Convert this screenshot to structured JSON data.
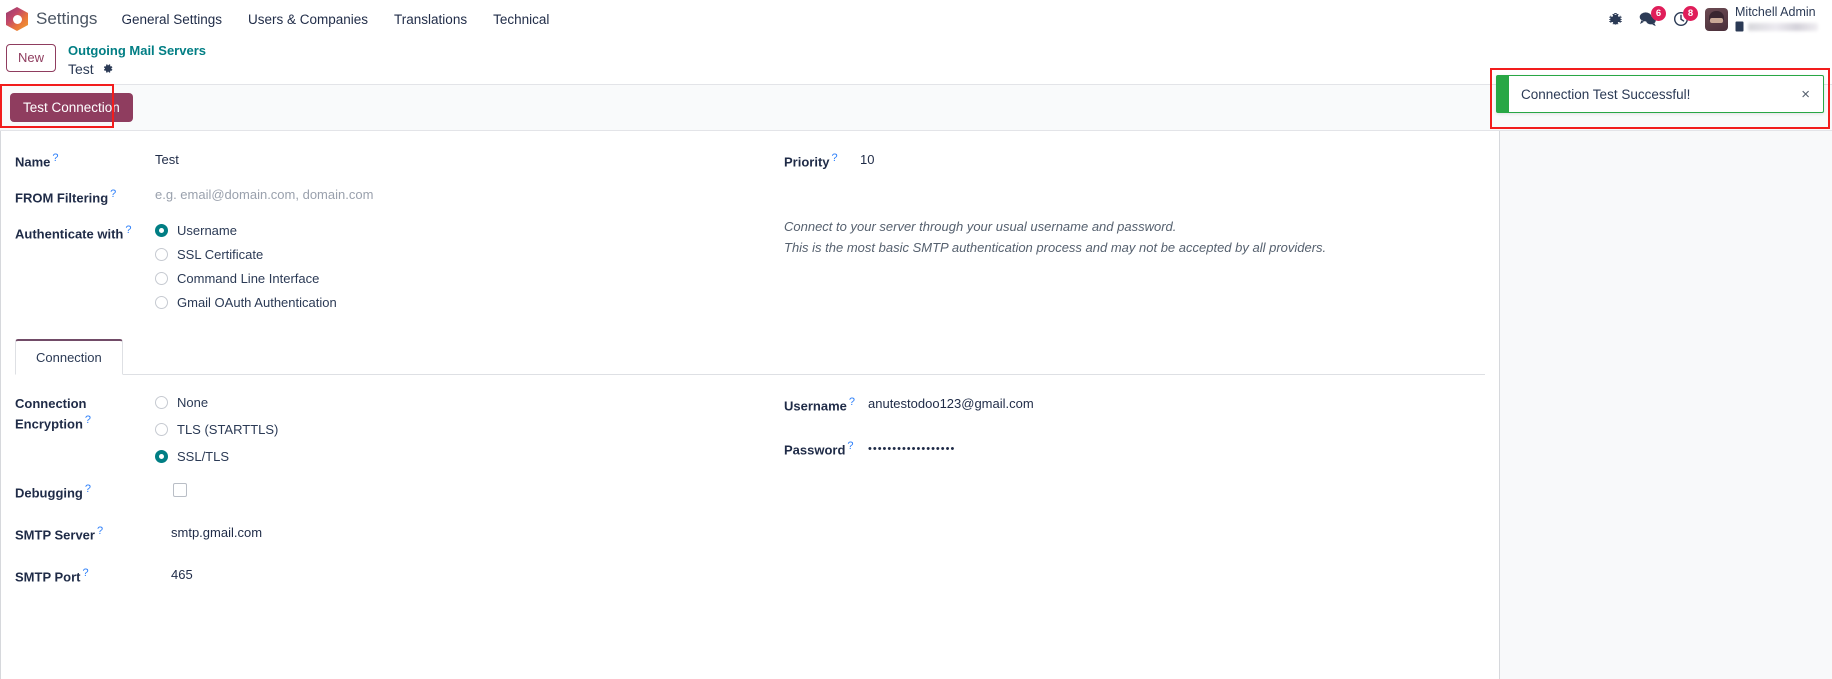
{
  "navbar": {
    "logo_icon": "odoo-logo-icon",
    "app_name": "Settings",
    "menu_items": [
      {
        "label": "General Settings"
      },
      {
        "label": "Users & Companies"
      },
      {
        "label": "Translations"
      },
      {
        "label": "Technical"
      }
    ],
    "icons": {
      "debug_icon": "bug-icon",
      "messaging_icon": "chat-bubble-icon",
      "messaging_badge": "6",
      "activities_icon": "clock-icon",
      "activities_badge": "8"
    },
    "user": {
      "avatar_icon": "user-avatar",
      "name": "Mitchell Admin",
      "sub_icon": "document-icon"
    }
  },
  "control_panel": {
    "new_button": "New",
    "breadcrumb_parent": "Outgoing Mail Servers",
    "breadcrumb_current": "Test",
    "settings_icon": "gear-icon"
  },
  "statusbar": {
    "test_connection_button": "Test Connection"
  },
  "toast": {
    "message": "Connection Test Successful!",
    "close_label": "×",
    "accent_color": "#28a745"
  },
  "form": {
    "name": {
      "label": "Name",
      "help": "?",
      "value": "Test"
    },
    "from_filtering": {
      "label": "FROM Filtering",
      "help": "?",
      "placeholder": "e.g. email@domain.com, domain.com",
      "value": ""
    },
    "authenticate_with": {
      "label": "Authenticate with",
      "help": "?",
      "selected": "Username",
      "options": [
        {
          "label": "Username",
          "checked": true
        },
        {
          "label": "SSL Certificate",
          "checked": false
        },
        {
          "label": "Command Line Interface",
          "checked": false
        },
        {
          "label": "Gmail OAuth Authentication",
          "checked": false
        }
      ]
    },
    "priority": {
      "label": "Priority",
      "help": "?",
      "value": "10"
    },
    "auth_help": {
      "line1": "Connect to your server through your usual username and password.",
      "line2": "This is the most basic SMTP authentication process and may not be accepted by all providers."
    }
  },
  "notebook": {
    "tabs": [
      {
        "label": "Connection",
        "active": true
      }
    ],
    "connection": {
      "encryption": {
        "label_line1": "Connection",
        "label_line2": "Encryption",
        "help": "?",
        "selected": "SSL/TLS",
        "options": [
          {
            "label": "None",
            "checked": false
          },
          {
            "label": "TLS (STARTTLS)",
            "checked": false
          },
          {
            "label": "SSL/TLS",
            "checked": true
          }
        ]
      },
      "debugging": {
        "label": "Debugging",
        "help": "?",
        "checked": false
      },
      "smtp_server": {
        "label": "SMTP Server",
        "help": "?",
        "value": "smtp.gmail.com"
      },
      "smtp_port": {
        "label": "SMTP Port",
        "help": "?",
        "value": "465"
      },
      "username": {
        "label": "Username",
        "help": "?",
        "value": "anutestodoo123@gmail.com"
      },
      "password": {
        "label": "Password",
        "help": "?",
        "value": "••••••••••••••••••"
      }
    }
  },
  "colors": {
    "primary": "#8f3d5f",
    "link": "#017e84",
    "accent_tab": "#714b67",
    "success": "#28a745",
    "annotation": "#f21d1d"
  }
}
